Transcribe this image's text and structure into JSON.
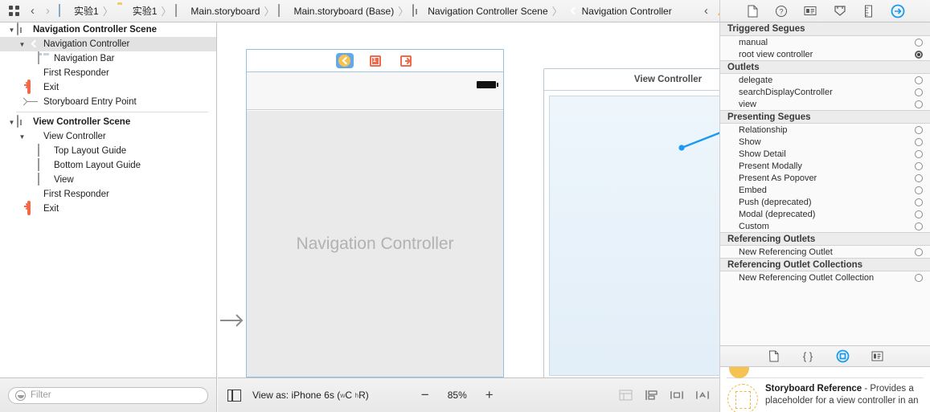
{
  "topbar": {
    "grid_icon": "grid-icon",
    "back_label": "‹",
    "forward_label": "›",
    "breadcrumbs": [
      {
        "label": "实验1",
        "icon": "project-file-icon"
      },
      {
        "label": "实验1",
        "icon": "folder-icon"
      },
      {
        "label": "Main.storyboard",
        "icon": "storyboard-icon"
      },
      {
        "label": "Main.storyboard (Base)",
        "icon": "storyboard-icon"
      },
      {
        "label": "Navigation Controller Scene",
        "icon": "scene-icon"
      },
      {
        "label": "Navigation Controller",
        "icon": "navigation-controller-icon"
      }
    ],
    "separator": "〉",
    "issue_prev": "‹",
    "issue_next": "›",
    "warning_badge": "warning-triangle-icon"
  },
  "inspector_tabs": [
    {
      "name": "file-inspector-icon",
      "selected": false
    },
    {
      "name": "quick-help-inspector-icon",
      "selected": false
    },
    {
      "name": "identity-inspector-icon",
      "selected": false
    },
    {
      "name": "attributes-inspector-icon",
      "selected": false
    },
    {
      "name": "size-inspector-icon",
      "selected": false
    },
    {
      "name": "connections-inspector-icon",
      "selected": true
    }
  ],
  "outline": {
    "rows": [
      {
        "label": "Navigation Controller Scene",
        "icon": "scene-icon",
        "indent": 0,
        "disclosure": "open",
        "bold": true,
        "selected": false
      },
      {
        "label": "Navigation Controller",
        "icon": "navigation-controller-icon",
        "indent": 1,
        "disclosure": "open",
        "bold": false,
        "selected": true
      },
      {
        "label": "Navigation Bar",
        "icon": "navigation-bar-icon",
        "indent": 3,
        "disclosure": "none",
        "bold": false,
        "selected": false
      },
      {
        "label": "First Responder",
        "icon": "first-responder-icon",
        "indent": 2,
        "disclosure": "none",
        "bold": false,
        "selected": false
      },
      {
        "label": "Exit",
        "icon": "exit-icon",
        "indent": 2,
        "disclosure": "none",
        "bold": false,
        "selected": false
      },
      {
        "label": "Storyboard Entry Point",
        "icon": "entry-point-icon",
        "indent": 2,
        "disclosure": "none",
        "bold": false,
        "selected": false
      },
      {
        "separator": true
      },
      {
        "label": "View Controller Scene",
        "icon": "scene-icon",
        "indent": 0,
        "disclosure": "open",
        "bold": true,
        "selected": false
      },
      {
        "label": "View Controller",
        "icon": "view-controller-icon",
        "indent": 1,
        "disclosure": "open",
        "bold": false,
        "selected": false
      },
      {
        "label": "Top Layout Guide",
        "icon": "top-layout-guide-icon",
        "indent": 3,
        "disclosure": "none",
        "bold": false,
        "selected": false
      },
      {
        "label": "Bottom Layout Guide",
        "icon": "bottom-layout-guide-icon",
        "indent": 3,
        "disclosure": "none",
        "bold": false,
        "selected": false
      },
      {
        "label": "View",
        "icon": "view-icon",
        "indent": 3,
        "disclosure": "none",
        "bold": false,
        "selected": false
      },
      {
        "label": "First Responder",
        "icon": "first-responder-icon",
        "indent": 2,
        "disclosure": "none",
        "bold": false,
        "selected": false
      },
      {
        "label": "Exit",
        "icon": "exit-icon",
        "indent": 2,
        "disclosure": "none",
        "bold": false,
        "selected": false
      }
    ]
  },
  "filter": {
    "placeholder": "Filter",
    "value": "",
    "icon": "filter-icon"
  },
  "canvas": {
    "nav_scene": {
      "title": "Navigation Controller",
      "dock_icons": [
        {
          "name": "navigation-controller-icon",
          "selected": true
        },
        {
          "name": "first-responder-icon",
          "selected": false
        },
        {
          "name": "exit-icon",
          "selected": false
        }
      ]
    },
    "vc_scene": {
      "title": "View Controller"
    },
    "entry_arrow": "storyboard-entry-arrow"
  },
  "canvasbar": {
    "view_toggle": "document-outline-toggle-icon",
    "view_as_prefix": "View as:",
    "device": "iPhone 6s",
    "traits_open": "(",
    "trait_w": "w",
    "trait_wv": "C",
    "trait_h": "h",
    "trait_hv": "R",
    "traits_close": ")",
    "zoom_out": "−",
    "zoom_value": "85%",
    "zoom_in": "+",
    "right_icons": [
      {
        "name": "nest-content-icon",
        "disabled": true
      },
      {
        "name": "align-icon",
        "disabled": false
      },
      {
        "name": "pin-icon",
        "disabled": false
      },
      {
        "name": "resolve-auto-layout-icon",
        "disabled": false
      }
    ]
  },
  "inspector": {
    "sections": [
      {
        "title": "Triggered Segues",
        "rows": [
          {
            "label": "manual",
            "connected": false
          },
          {
            "label": "root view controller",
            "connected": true
          }
        ]
      },
      {
        "title": "Outlets",
        "rows": [
          {
            "label": "delegate",
            "connected": false
          },
          {
            "label": "searchDisplayController",
            "connected": false
          },
          {
            "label": "view",
            "connected": false
          }
        ]
      },
      {
        "title": "Presenting Segues",
        "rows": [
          {
            "label": "Relationship",
            "connected": false
          },
          {
            "label": "Show",
            "connected": false
          },
          {
            "label": "Show Detail",
            "connected": false
          },
          {
            "label": "Present Modally",
            "connected": false
          },
          {
            "label": "Present As Popover",
            "connected": false
          },
          {
            "label": "Embed",
            "connected": false
          },
          {
            "label": "Push (deprecated)",
            "connected": false
          },
          {
            "label": "Modal (deprecated)",
            "connected": false
          },
          {
            "label": "Custom",
            "connected": false
          }
        ]
      },
      {
        "title": "Referencing Outlets",
        "rows": [
          {
            "label": "New Referencing Outlet",
            "connected": false
          }
        ]
      },
      {
        "title": "Referencing Outlet Collections",
        "rows": [
          {
            "label": "New Referencing Outlet Collection",
            "connected": false
          }
        ]
      }
    ]
  },
  "library": {
    "tabs": [
      {
        "name": "file-template-library-icon",
        "selected": false
      },
      {
        "name": "code-snippet-library-icon",
        "selected": false
      },
      {
        "name": "object-library-icon",
        "selected": true
      },
      {
        "name": "media-library-icon",
        "selected": false
      }
    ],
    "item": {
      "title": "Storyboard Reference",
      "description": " - Provides a placeholder for a view controller in an",
      "icon": "storyboard-reference-icon"
    }
  },
  "colors": {
    "accent": "#1a9bf0",
    "selection": "#63a9e8",
    "warning": "#f5b731",
    "controller_yellow": "#f6c352",
    "exit_orange": "#f0694a",
    "canvas_line": "#1a9bf0"
  }
}
